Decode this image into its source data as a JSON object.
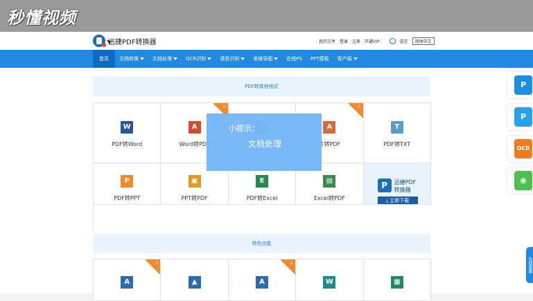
{
  "watermark": "秒懂视频",
  "header": {
    "logo_text": "迅捷PDF转换器",
    "links": [
      "我的文件",
      "登录",
      "注册",
      "开通VIP"
    ],
    "lang_icon_label": "语言",
    "lang_select": "简体中文"
  },
  "nav": {
    "items": [
      {
        "label": "首页",
        "caret": false
      },
      {
        "label": "文档转换",
        "caret": true
      },
      {
        "label": "文档处理",
        "caret": true
      },
      {
        "label": "OCR识别",
        "caret": true
      },
      {
        "label": "语音识别",
        "caret": true
      },
      {
        "label": "思维导图",
        "caret": true
      },
      {
        "label": "在线PS",
        "caret": false
      },
      {
        "label": "PPT模板",
        "caret": false
      },
      {
        "label": "客户端",
        "caret": true
      }
    ]
  },
  "sections": {
    "formats_title": "PDF转其他格式",
    "features_title": "特色功能"
  },
  "grid1": [
    {
      "label": "PDF转Word",
      "icon": "word-icon",
      "glyph": "W",
      "color": "#2b5797",
      "hot": false
    },
    {
      "label": "Word转PDF",
      "icon": "pdf-icon",
      "glyph": "A",
      "color": "#d64b2b",
      "hot": true
    },
    {
      "label": "",
      "icon": "pdf-icon",
      "glyph": "A",
      "color": "#d64b2b",
      "hot": false
    },
    {
      "label": "片转PDF",
      "icon": "image-pdf-icon",
      "glyph": "A",
      "color": "#d96a3a",
      "hot": true
    },
    {
      "label": "PDF转TXT",
      "icon": "txt-icon",
      "glyph": "T",
      "color": "#5b9bc9",
      "hot": false
    }
  ],
  "grid2": [
    {
      "label": "PDF转PPT",
      "icon": "ppt-icon",
      "glyph": "P",
      "color": "#f08a2c",
      "hot": false
    },
    {
      "label": "PPT转PDF",
      "icon": "ppt-pdf-icon",
      "glyph": "▣",
      "color": "#e09a1e",
      "hot": false
    },
    {
      "label": "PDF转Excel",
      "icon": "excel-icon",
      "glyph": "E",
      "color": "#1f8a4c",
      "hot": false
    },
    {
      "label": "Excel转PDF",
      "icon": "excel-pdf-icon",
      "glyph": "▤",
      "color": "#3a8a4f",
      "hot": false
    }
  ],
  "promo": {
    "line1": "迅捷PDF",
    "line2": "转换器",
    "button": "立即下载"
  },
  "grid3": [
    {
      "icon": "pdf-doc-icon",
      "glyph": "A",
      "color": "#2b6cb0",
      "hot": true
    },
    {
      "icon": "image-icon",
      "glyph": "▲",
      "color": "#2b6cb0",
      "hot": false
    },
    {
      "icon": "font-icon",
      "glyph": "A",
      "color": "#2b6cb0",
      "hot": true
    },
    {
      "icon": "word-icon",
      "glyph": "W",
      "color": "#1f8a8a",
      "hot": false
    },
    {
      "icon": "doc-icon",
      "glyph": "▦",
      "color": "#1f8a6a",
      "hot": false
    }
  ],
  "tip": {
    "title": "小提示：",
    "body": "文档处理"
  },
  "sidebar": [
    {
      "icon": "pdf-app-icon",
      "glyph": "P",
      "color": "#1a8fe0"
    },
    {
      "icon": "pdf-editor-icon",
      "glyph": "P",
      "color": "#2aa0e8"
    },
    {
      "icon": "ocr-icon",
      "glyph": "OCR",
      "color": "#f07a1e"
    },
    {
      "icon": "wechat-icon",
      "glyph": "◉",
      "color": "#4cbf4c"
    }
  ],
  "feedback": "在线客服"
}
